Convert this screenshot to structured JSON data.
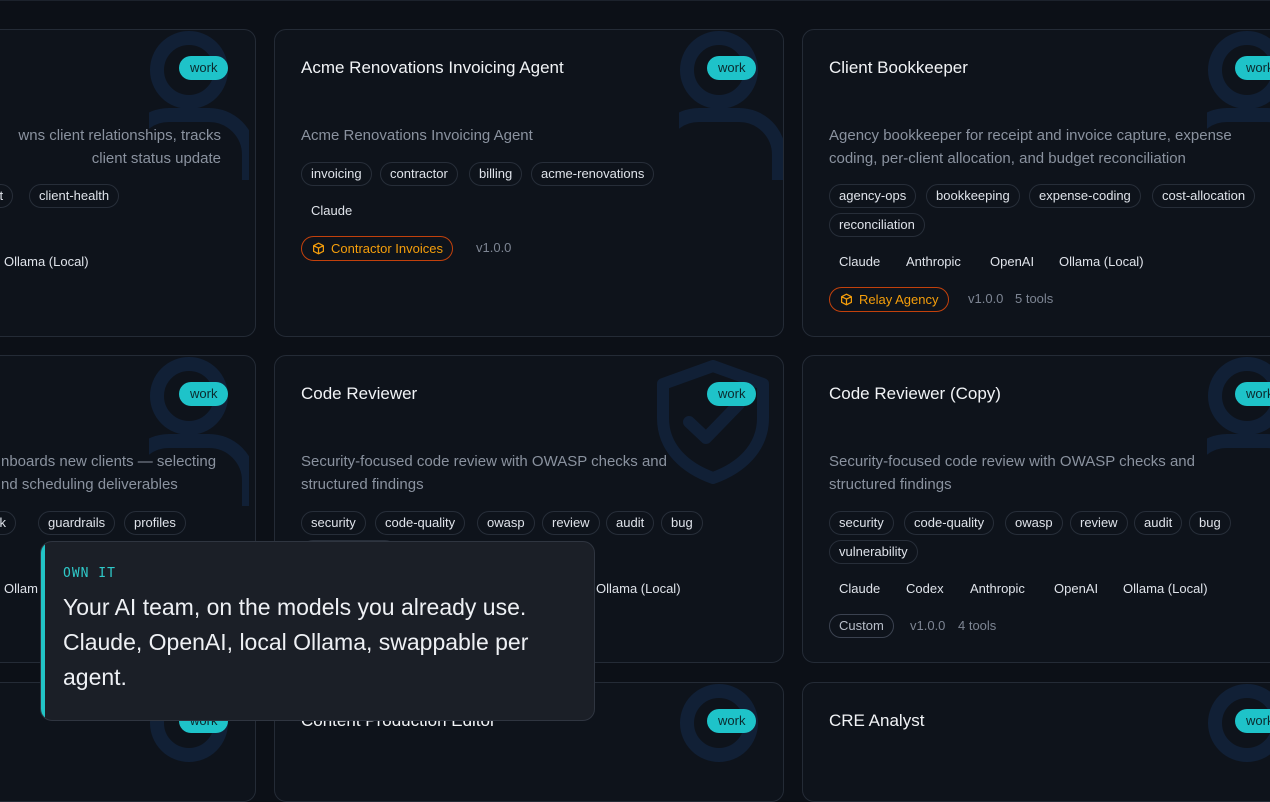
{
  "colors": {
    "background": "#0c1017",
    "card": "#0e131b",
    "badge": "#1ec3c9",
    "package_border": "#c2410c",
    "package_text": "#f59e0b",
    "callout_accent": "#22c4c6",
    "watermark": "#112036"
  },
  "cards": [
    {
      "title": "",
      "badge": "work",
      "watermark": "person-icon",
      "desc_lines": [
        "wns client relationships, tracks",
        "client status update"
      ],
      "tags": [
        "ent",
        "client-health"
      ],
      "models": [
        "Ollama (Local)"
      ]
    },
    {
      "title": "Acme Renovations Invoicing Agent",
      "badge": "work",
      "watermark": "person-icon",
      "desc_lines": [
        "Acme Renovations Invoicing Agent"
      ],
      "tags": [
        "invoicing",
        "contractor",
        "billing",
        "acme-renovations"
      ],
      "models": [
        "Claude"
      ],
      "package": "Contractor Invoices",
      "package_icon": "box-icon",
      "version": "v1.0.0"
    },
    {
      "title": "Client Bookkeeper",
      "badge": "work",
      "watermark": "person-icon",
      "desc_lines": [
        "Agency bookkeeper for receipt and invoice capture, expense",
        "coding, per-client allocation, and budget reconciliation"
      ],
      "tags": [
        "agency-ops",
        "bookkeeping",
        "expense-coding",
        "cost-allocation",
        "reconciliation"
      ],
      "models": [
        "Claude",
        "Anthropic",
        "OpenAI",
        "Ollama (Local)"
      ],
      "package": "Relay Agency",
      "package_icon": "box-icon",
      "version": "v1.0.0",
      "tools": "5 tools"
    },
    {
      "title": "",
      "badge": "work",
      "watermark": "person-icon",
      "desc_lines": [
        "nboards new clients — selecting",
        "nd scheduling deliverables"
      ],
      "tags": [
        "ook",
        "guardrails",
        "profiles"
      ],
      "models": [
        "Ollam"
      ]
    },
    {
      "title": "Code Reviewer",
      "badge": "work",
      "watermark": "shield-check-icon",
      "desc_lines": [
        "Security-focused code review with OWASP checks and",
        "structured findings"
      ],
      "tags": [
        "security",
        "code-quality",
        "owasp",
        "review",
        "audit",
        "bug"
      ],
      "models": [
        "Ollama (Local)"
      ]
    },
    {
      "title": "Code Reviewer (Copy)",
      "badge": "work",
      "watermark": "person-icon",
      "desc_lines": [
        "Security-focused code review with OWASP checks and",
        "structured findings"
      ],
      "tags": [
        "security",
        "code-quality",
        "owasp",
        "review",
        "audit",
        "bug",
        "vulnerability"
      ],
      "models": [
        "Claude",
        "Codex",
        "Anthropic",
        "OpenAI",
        "Ollama (Local)"
      ],
      "custom_label": "Custom",
      "version": "v1.0.0",
      "tools": "4 tools"
    },
    {
      "title": "",
      "badge": "work",
      "watermark": "person-icon"
    },
    {
      "title": "Content Production Editor",
      "badge": "work",
      "watermark": "person-icon"
    },
    {
      "title": "CRE Analyst",
      "badge": "work",
      "watermark": "person-icon"
    }
  ],
  "callout": {
    "eyebrow": "OWN IT",
    "headline": "Your AI team, on the models you already use. Claude, OpenAI, local Ollama, swappable per agent."
  }
}
